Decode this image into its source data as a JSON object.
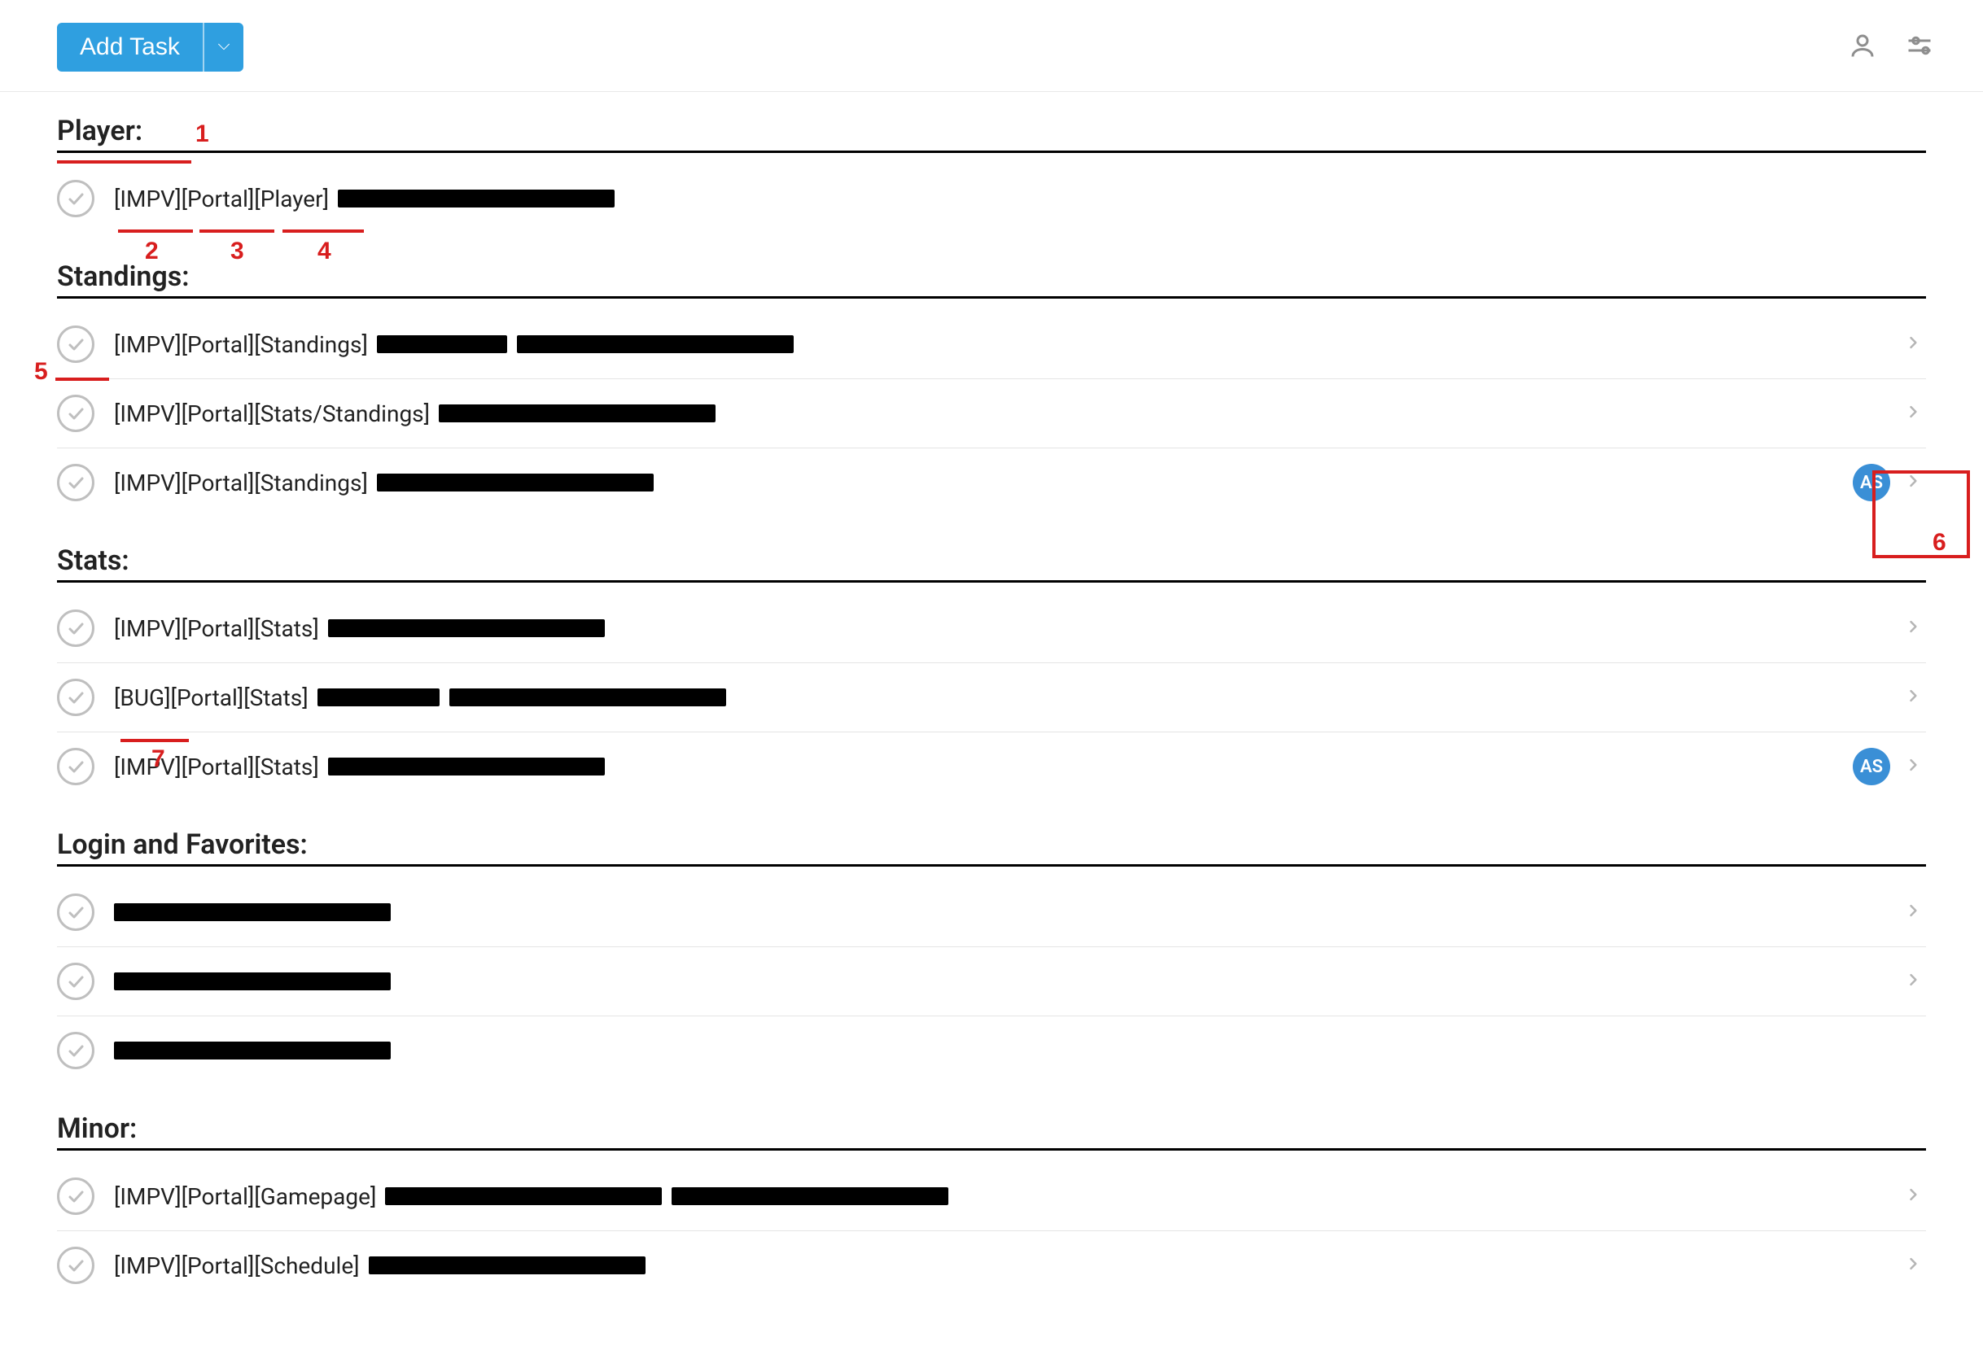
{
  "toolbar": {
    "add_task_label": "Add Task"
  },
  "avatar_initials": "AS",
  "annotations": {
    "a1": "1",
    "a2": "2",
    "a3": "3",
    "a4": "4",
    "a5": "5",
    "a6": "6",
    "a7": "7"
  },
  "sections": [
    {
      "title": "Player:",
      "tasks": [
        {
          "prefix": "[IMPV][Portal][Player] ",
          "redacted_widths": [
            340
          ],
          "has_chevron": false
        }
      ]
    },
    {
      "title": "Standings:",
      "tasks": [
        {
          "prefix": "[IMPV][Portal][Standings] ",
          "redacted_widths": [
            160,
            340
          ],
          "has_chevron": true
        },
        {
          "prefix": "[IMPV][Portal][Stats/Standings] ",
          "redacted_widths": [
            340
          ],
          "has_chevron": true
        },
        {
          "prefix": "[IMPV][Portal][Standings] ",
          "redacted_widths": [
            340
          ],
          "has_avatar": true,
          "has_chevron": true
        }
      ]
    },
    {
      "title": "Stats:",
      "tasks": [
        {
          "prefix": "[IMPV][Portal][Stats] ",
          "redacted_widths": [
            340
          ],
          "has_chevron": true
        },
        {
          "prefix": "[BUG][Portal][Stats] ",
          "redacted_widths": [
            150,
            340
          ],
          "has_chevron": true
        },
        {
          "prefix": "[IMPV][Portal][Stats] ",
          "redacted_widths": [
            340
          ],
          "has_avatar": true,
          "has_chevron": true
        }
      ]
    },
    {
      "title": "Login and Favorites:",
      "tasks": [
        {
          "prefix": "",
          "redacted_widths": [
            340
          ],
          "has_chevron": true
        },
        {
          "prefix": "",
          "redacted_widths": [
            340
          ],
          "has_chevron": true
        },
        {
          "prefix": "",
          "redacted_widths": [
            340
          ],
          "has_chevron": false
        }
      ]
    },
    {
      "title": "Minor:",
      "tasks": [
        {
          "prefix": "[IMPV][Portal][Gamepage] ",
          "redacted_widths": [
            340,
            340
          ],
          "has_chevron": true
        },
        {
          "prefix": "[IMPV][Portal][Schedule] ",
          "redacted_widths": [
            340
          ],
          "has_chevron": true
        }
      ]
    }
  ]
}
